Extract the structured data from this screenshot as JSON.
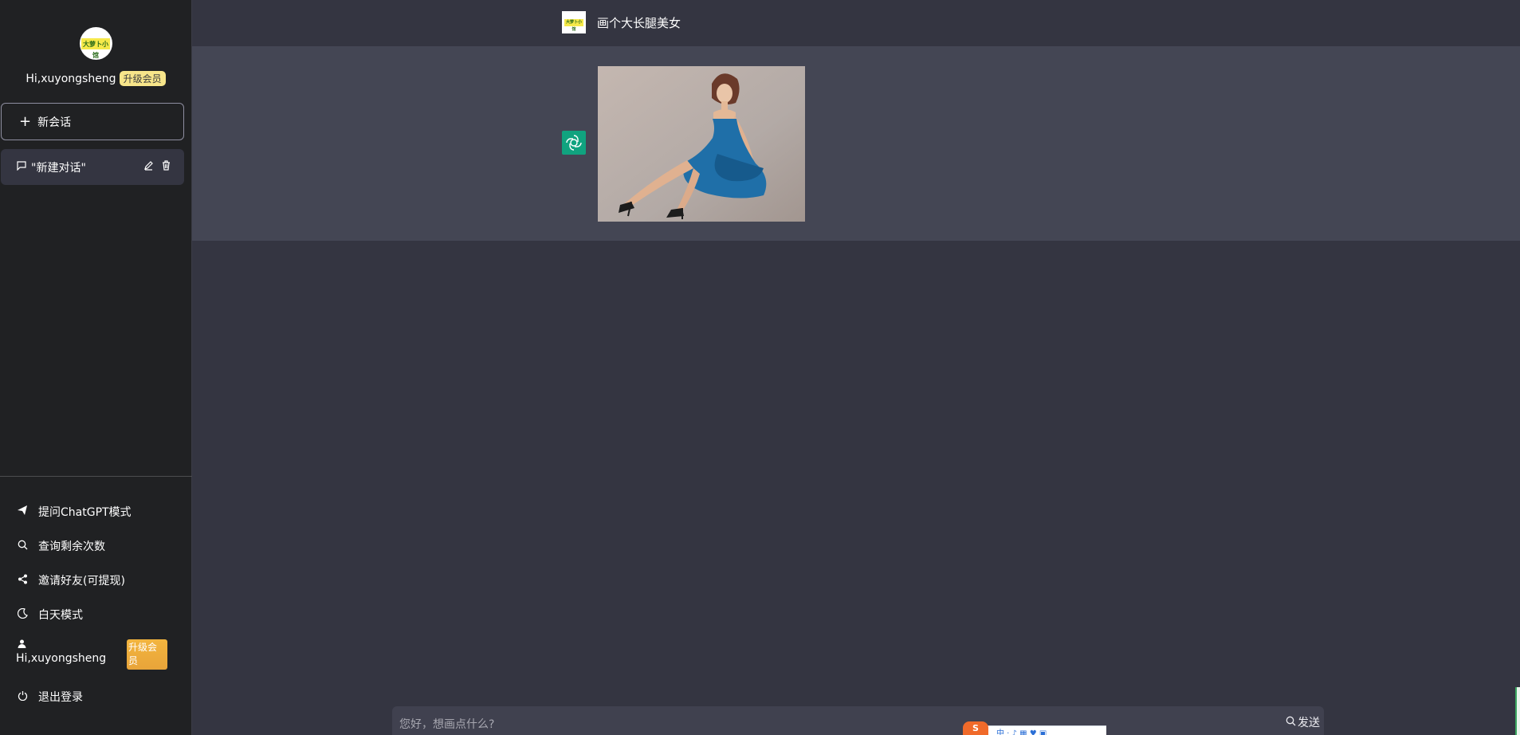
{
  "sidebar": {
    "logo_text": "大萝卜小馆",
    "greeting": "Hi,xuyongsheng",
    "vip_badge": "升级会员",
    "new_chat_label": "新会话",
    "conversations": [
      {
        "title": "\"新建对话\""
      }
    ],
    "menu": {
      "ask_chatgpt": "提问ChatGPT模式",
      "query_remaining": "查询剩余次数",
      "invite_friends": "邀请好友(可提现)",
      "day_mode": "白天模式",
      "user_name": "Hi,xuyongsheng",
      "upgrade": "升级会员",
      "logout": "退出登录"
    }
  },
  "chat": {
    "user_prompt": "画个大长腿美女",
    "user_avatar_text": "大萝卜小馆"
  },
  "input": {
    "placeholder": "您好，想画点什么?",
    "send_label": "发送"
  },
  "ime": {
    "logo": "S",
    "text": "中 · ♪ ▦ ♥ ▣"
  },
  "colors": {
    "sidebar_bg": "#202123",
    "main_bg": "#343541",
    "answer_bg": "#444654",
    "bot_avatar": "#10a37f",
    "vip_badge": "#f7e58a",
    "upgrade_btn": "#f3b53e"
  }
}
